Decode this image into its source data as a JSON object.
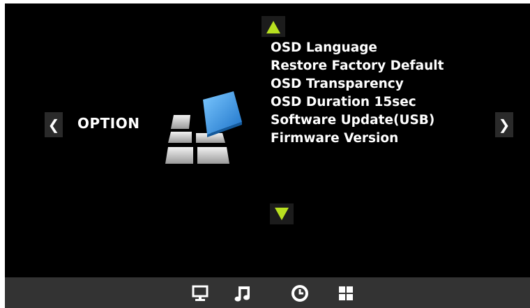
{
  "nav": {
    "left_arrow": "❮",
    "right_arrow": "❯"
  },
  "page": {
    "title": "OPTION"
  },
  "menu": {
    "items": [
      {
        "label": "OSD Language"
      },
      {
        "label": "Restore Factory Default"
      },
      {
        "label": "OSD Transparency"
      },
      {
        "label": "OSD Duration  15sec"
      },
      {
        "label": "Software Update(USB)"
      },
      {
        "label": "Firmware Version"
      }
    ]
  },
  "colors": {
    "screen_bg": "#000000",
    "accent_green": "#b8e020",
    "bottom_bar": "#333333",
    "option_tile_blue": "#2f8fe0"
  },
  "bottom_bar": {
    "icons": [
      "monitor-icon",
      "music-icon",
      "clock-icon",
      "grid-icon"
    ],
    "active_icon": "clock-icon"
  }
}
